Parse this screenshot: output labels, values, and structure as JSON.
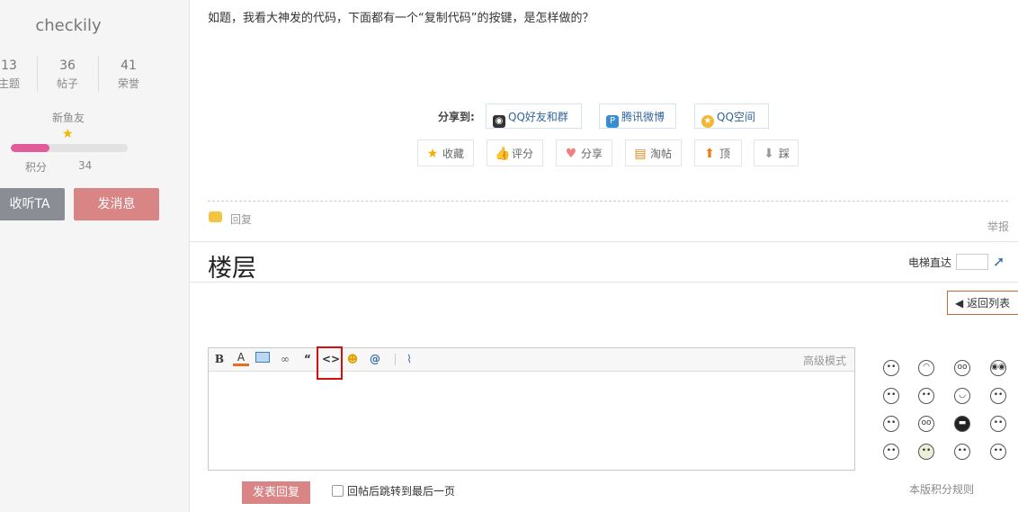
{
  "sidebar": {
    "username": "checkily",
    "stats": [
      {
        "value": "13",
        "label": "主题"
      },
      {
        "value": "36",
        "label": "帖子"
      },
      {
        "value": "41",
        "label": "荣誉"
      }
    ],
    "level": "新鱼友",
    "progress": 0.33,
    "points_label": "积分",
    "points_value": "34",
    "listen_button": "收听TA",
    "message_button": "发消息"
  },
  "post": {
    "text": "如题，我看大神发的代码，下面都有一个“复制代码”的按键，是怎样做的？",
    "share_label": "分享到:",
    "share_buttons": [
      "QQ好友和群",
      "腾讯微博",
      "QQ空间"
    ],
    "actions": [
      "收藏",
      "评分",
      "分享",
      "淘帖",
      "顶",
      "踩"
    ],
    "reply": "回复",
    "report": "举报"
  },
  "floor": {
    "title": "楼层",
    "elevator_label": "电梯直达",
    "back_to_list": "返回列表"
  },
  "editor": {
    "advanced_mode": "高级模式",
    "toolbar_icons": [
      "bold-icon",
      "font-color-icon",
      "image-icon",
      "link-icon",
      "quote-icon",
      "code-icon",
      "smiley-icon",
      "at-icon",
      "attachment-icon"
    ]
  },
  "footer": {
    "submit_button": "发表回复",
    "jump_label": "回帖后跳转到最后一页",
    "rules_link": "本版积分规则"
  },
  "colors": {
    "accent": "#d98585",
    "progress": "#e15b9a",
    "highlight": "#d31010"
  }
}
